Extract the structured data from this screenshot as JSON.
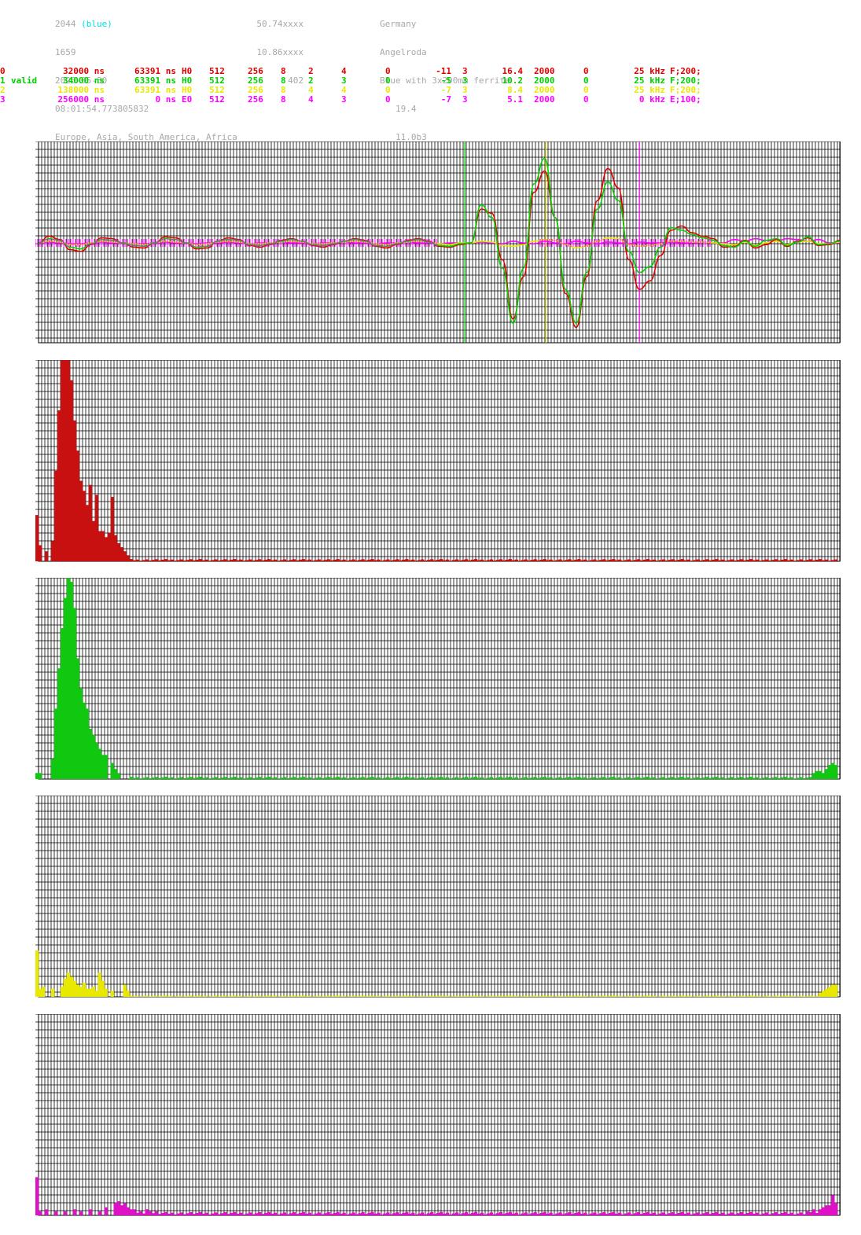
{
  "header": {
    "col1": [
      "2044",
      "1659",
      "2026-05-30",
      "08:01:54.773805832",
      "Europe, Asia, South America, Africa"
    ],
    "col1_suffix": "(blue)",
    "col2": [
      "50.74xxxx",
      "10.86xxxx",
      "402"
    ],
    "col3": [
      "Germany",
      "Angelroda",
      "Blue with 3x200mm ferrite",
      "19.4",
      "11.0b3"
    ]
  },
  "channels": [
    {
      "id": "0",
      "label": "",
      "t1": "32000 ns",
      "t2": "63391 ns",
      "mode": "H0",
      "a": "512",
      "b": "256",
      "c": "8",
      "d": "2",
      "e": "4",
      "f": "0",
      "g": "-11",
      "h": "3",
      "amp": "16.4",
      "rate": "2000",
      "z": "0",
      "freq": "25 kHz",
      "flt": "F;200;",
      "color": "#e00000"
    },
    {
      "id": "1",
      "label": "valid",
      "t1": "34000 ns",
      "t2": "63391 ns",
      "mode": "H0",
      "a": "512",
      "b": "256",
      "c": "8",
      "d": "2",
      "e": "3",
      "f": "0",
      "g": "-5",
      "h": "3",
      "amp": "10.2",
      "rate": "2000",
      "z": "0",
      "freq": "25 kHz",
      "flt": "F;200;",
      "color": "#00d000"
    },
    {
      "id": "2",
      "label": "",
      "t1": "138000 ns",
      "t2": "63391 ns",
      "mode": "H0",
      "a": "512",
      "b": "256",
      "c": "8",
      "d": "4",
      "e": "4",
      "f": "0",
      "g": "-7",
      "h": "3",
      "amp": "8.4",
      "rate": "2000",
      "z": "0",
      "freq": "25 kHz",
      "flt": "F;200;",
      "color": "#e8e800"
    },
    {
      "id": "3",
      "label": "",
      "t1": "256000 ns",
      "t2": "0 ns",
      "mode": "E0",
      "a": "512",
      "b": "256",
      "c": "8",
      "d": "4",
      "e": "3",
      "f": "0",
      "g": "-7",
      "h": "3",
      "amp": "5.1",
      "rate": "2000",
      "z": "0",
      "freq": "0 kHz",
      "flt": "E;100;",
      "color": "#ff00ff"
    }
  ],
  "chart_data": [
    {
      "type": "line",
      "series": [
        {
          "values": [
            0,
            0.08,
            0.04,
            -0.08,
            -0.1,
            -0.02,
            0.06,
            0.05,
            0,
            -0.05,
            -0.06,
            0,
            0.07,
            0.06,
            0,
            -0.07,
            -0.06,
            0.02,
            0.06,
            0.04,
            -0.03,
            -0.05,
            -0.02,
            0.03,
            0.05,
            0.02,
            -0.03,
            -0.05,
            -0.02,
            0.02,
            0.05,
            0.03,
            -0.04,
            -0.06,
            -0.02,
            0.03,
            0.05,
            0.02,
            -0.04,
            -0.05,
            -0.02,
            0,
            0.4,
            0.35,
            -0.2,
            -0.9,
            -0.4,
            0.6,
            0.85,
            0.3,
            -0.6,
            -1,
            -0.4,
            0.5,
            0.88,
            0.65,
            -0.2,
            -0.55,
            -0.45,
            -0.15,
            0.15,
            0.2,
            0.12,
            0.08,
            0.05,
            -0.05,
            -0.04,
            0.03,
            -0.06,
            -0.02,
            0.04,
            -0.04,
            0.02,
            0.06,
            -0.03,
            -0.02,
            0.03
          ]
        },
        {
          "values": [
            0,
            0.05,
            0.03,
            -0.05,
            -0.07,
            -0.01,
            0.04,
            0.03,
            0,
            -0.03,
            -0.04,
            0,
            0.05,
            0.04,
            0,
            -0.05,
            -0.04,
            0.02,
            0.04,
            0.03,
            -0.02,
            -0.03,
            -0.01,
            0.02,
            0.04,
            0.02,
            -0.02,
            -0.03,
            -0.01,
            0.02,
            0.04,
            0.02,
            -0.03,
            -0.04,
            -0.01,
            0.02,
            0.04,
            0.01,
            -0.03,
            -0.04,
            -0.01,
            0,
            0.45,
            0.3,
            -0.3,
            -0.95,
            -0.3,
            0.7,
            1,
            0.3,
            -0.55,
            -0.95,
            -0.35,
            0.4,
            0.72,
            0.5,
            -0.1,
            -0.35,
            -0.28,
            -0.05,
            0.18,
            0.15,
            0.1,
            0.06,
            0.03,
            -0.03,
            -0.05,
            0.02,
            -0.04,
            0.03,
            0.05,
            -0.03,
            0.01,
            0.07,
            -0.02,
            -0.01,
            0.02
          ]
        },
        {
          "values": [
            0,
            0.02,
            0.01,
            -0.02,
            -0.02,
            0,
            0.02,
            0.01,
            0,
            -0.01,
            -0.02,
            0,
            0.02,
            0.01,
            0,
            -0.02,
            -0.01,
            0.01,
            0.02,
            0.01,
            -0.01,
            -0.01,
            0,
            0.01,
            0.02,
            0.01,
            -0.01,
            -0.01,
            0,
            0.01,
            0.02,
            0.01,
            -0.01,
            -0.02,
            0,
            0.01,
            0.02,
            0.01,
            -0.01,
            -0.02,
            0,
            0,
            0.02,
            0.01,
            -0.03,
            -0.04,
            -0.02,
            0.02,
            0.04,
            0.03,
            -0.02,
            -0.06,
            -0.04,
            0.02,
            0.06,
            0.05,
            -0.02,
            -0.04,
            -0.03,
            -0.01,
            0.02,
            0.02,
            0.01,
            0.01,
            0,
            -0.01,
            -0.02,
            0.01,
            -0.03,
            0,
            0.02,
            -0.02,
            0.01,
            0.02,
            -0.01,
            -0.01,
            0.01
          ]
        },
        {
          "values": [
            0,
            0.01,
            0,
            -0.01,
            -0.01,
            0,
            0.01,
            0,
            0,
            -0.01,
            -0.01,
            0,
            0.01,
            0,
            0,
            -0.01,
            0,
            0,
            0.01,
            0,
            -0.01,
            0,
            0,
            0.01,
            0,
            0,
            -0.01,
            0,
            0,
            0.01,
            0,
            0,
            -0.01,
            0,
            0,
            0.01,
            0,
            0,
            -0.01,
            0,
            0,
            0,
            0.01,
            0,
            -0.01,
            0.02,
            0,
            -0.01,
            0.02,
            0,
            -0.01,
            0.02,
            0,
            -0.01,
            0.01,
            0,
            -0.01,
            0.01,
            0,
            0,
            0.01,
            0,
            0,
            0.01,
            0,
            0,
            0.04,
            0.02,
            0.05,
            0.03,
            0.02,
            0.05,
            0.04,
            0.02,
            0.04,
            0,
            0
          ]
        }
      ],
      "markers": [
        0.532,
        0.633,
        0.75
      ],
      "ylim": [
        -1.2,
        1.2
      ]
    },
    {
      "type": "bar",
      "bins": 256,
      "peaks": [
        [
          0,
          0.23
        ],
        [
          1,
          0.08
        ],
        [
          3,
          0.05
        ],
        [
          5,
          0.1
        ],
        [
          6,
          0.45
        ],
        [
          7,
          0.75
        ],
        [
          8,
          1.0
        ],
        [
          9,
          1.0
        ],
        [
          10,
          1.0
        ],
        [
          11,
          0.9
        ],
        [
          12,
          0.7
        ],
        [
          13,
          0.55
        ],
        [
          14,
          0.4
        ],
        [
          15,
          0.35
        ],
        [
          16,
          0.28
        ],
        [
          17,
          0.38
        ],
        [
          18,
          0.2
        ],
        [
          19,
          0.33
        ],
        [
          20,
          0.15
        ],
        [
          21,
          0.15
        ],
        [
          22,
          0.12
        ],
        [
          23,
          0.14
        ],
        [
          24,
          0.32
        ],
        [
          25,
          0.13
        ],
        [
          26,
          0.09
        ],
        [
          27,
          0.07
        ],
        [
          28,
          0.05
        ],
        [
          29,
          0.03
        ]
      ],
      "floor": 0.008,
      "tail": []
    },
    {
      "type": "bar",
      "bins": 256,
      "peaks": [
        [
          0,
          0.03
        ],
        [
          1,
          0.03
        ],
        [
          5,
          0.1
        ],
        [
          6,
          0.35
        ],
        [
          7,
          0.55
        ],
        [
          8,
          0.75
        ],
        [
          9,
          0.9
        ],
        [
          10,
          1.0
        ],
        [
          11,
          0.98
        ],
        [
          12,
          0.85
        ],
        [
          13,
          0.6
        ],
        [
          14,
          0.45
        ],
        [
          15,
          0.38
        ],
        [
          16,
          0.35
        ],
        [
          17,
          0.25
        ],
        [
          18,
          0.22
        ],
        [
          19,
          0.18
        ],
        [
          20,
          0.15
        ],
        [
          21,
          0.12
        ],
        [
          22,
          0.12
        ],
        [
          24,
          0.08
        ],
        [
          25,
          0.05
        ],
        [
          26,
          0.03
        ]
      ],
      "floor": 0.008,
      "tail": [
        [
          248,
          0.03
        ],
        [
          249,
          0.04
        ],
        [
          250,
          0.04
        ],
        [
          251,
          0.03
        ],
        [
          252,
          0.05
        ],
        [
          253,
          0.07
        ],
        [
          254,
          0.08
        ],
        [
          255,
          0.07
        ]
      ]
    },
    {
      "type": "bar",
      "bins": 256,
      "peaks": [
        [
          0,
          0.23
        ],
        [
          1,
          0.04
        ],
        [
          2,
          0.05
        ],
        [
          5,
          0.04
        ],
        [
          8,
          0.05
        ],
        [
          9,
          0.09
        ],
        [
          10,
          0.12
        ],
        [
          11,
          0.1
        ],
        [
          12,
          0.08
        ],
        [
          13,
          0.06
        ],
        [
          14,
          0.05
        ],
        [
          15,
          0.07
        ],
        [
          16,
          0.04
        ],
        [
          17,
          0.04
        ],
        [
          18,
          0.05
        ],
        [
          19,
          0.03
        ],
        [
          20,
          0.12
        ],
        [
          21,
          0.08
        ],
        [
          22,
          0.04
        ],
        [
          24,
          0.03
        ],
        [
          28,
          0.06
        ],
        [
          29,
          0.03
        ]
      ],
      "floor": 0.004,
      "tail": [
        [
          250,
          0.02
        ],
        [
          251,
          0.03
        ],
        [
          252,
          0.04
        ],
        [
          253,
          0.05
        ],
        [
          254,
          0.06
        ],
        [
          255,
          0.06
        ]
      ]
    },
    {
      "type": "bar",
      "bins": 256,
      "peaks": [
        [
          0,
          0.19
        ],
        [
          1,
          0.02
        ],
        [
          3,
          0.03
        ],
        [
          6,
          0.02
        ],
        [
          9,
          0.02
        ],
        [
          12,
          0.03
        ],
        [
          14,
          0.02
        ],
        [
          17,
          0.03
        ],
        [
          20,
          0.02
        ],
        [
          22,
          0.04
        ],
        [
          25,
          0.06
        ],
        [
          26,
          0.07
        ],
        [
          27,
          0.05
        ],
        [
          28,
          0.06
        ],
        [
          29,
          0.04
        ],
        [
          30,
          0.03
        ],
        [
          31,
          0.03
        ],
        [
          33,
          0.02
        ],
        [
          35,
          0.03
        ],
        [
          36,
          0.02
        ],
        [
          38,
          0.02
        ]
      ],
      "floor": 0.012,
      "tail": [
        [
          246,
          0.02
        ],
        [
          248,
          0.03
        ],
        [
          250,
          0.03
        ],
        [
          251,
          0.04
        ],
        [
          252,
          0.05
        ],
        [
          253,
          0.05
        ],
        [
          254,
          0.1
        ],
        [
          255,
          0.06
        ]
      ]
    }
  ]
}
